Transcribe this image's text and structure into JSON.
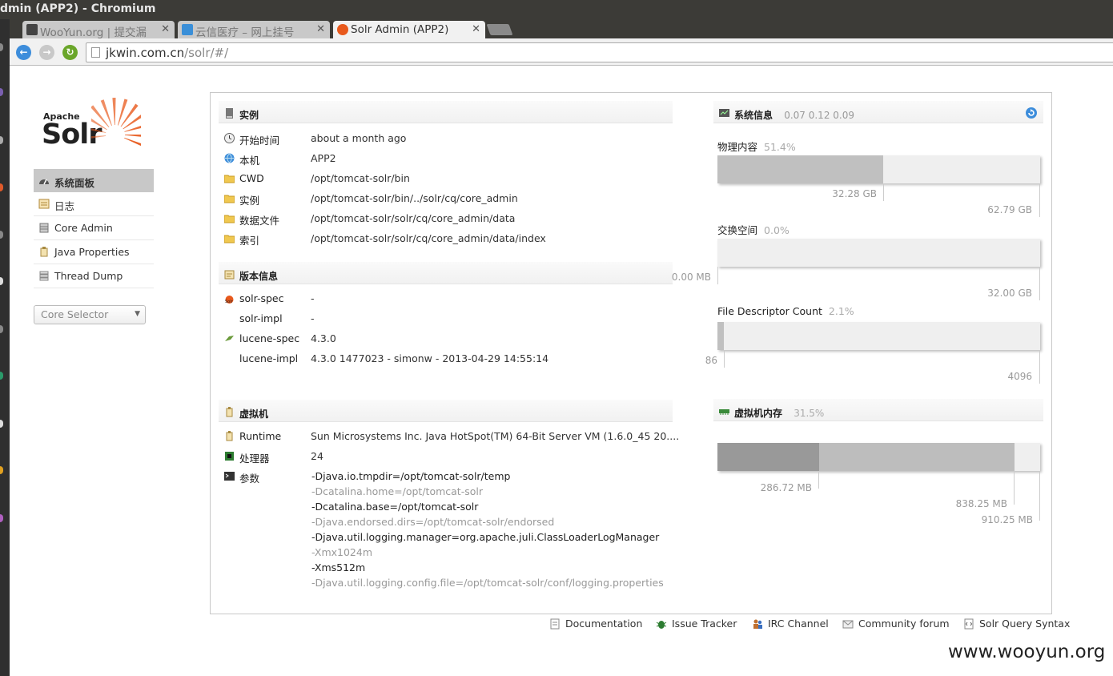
{
  "window": {
    "title": "dmin (APP2) - Chromium"
  },
  "tabs": [
    {
      "label": "WooYun.org | 提交漏",
      "favicon_color": "#444444"
    },
    {
      "label": "云信医疗 – 网上挂号",
      "favicon_color": "#3a8fd8"
    },
    {
      "label": "Solr Admin (APP2)",
      "favicon_color": "#e8591c"
    }
  ],
  "omnibox": {
    "host": "jkwin.com.cn",
    "path": "/solr/#/"
  },
  "nav": {
    "back": "←",
    "forward": "→",
    "reload": "↻"
  },
  "logo": {
    "apache": "Apache",
    "solr": "Solr"
  },
  "menu": [
    {
      "label": "系统面板"
    },
    {
      "label": "日志"
    },
    {
      "label": "Core Admin"
    },
    {
      "label": "Java Properties"
    },
    {
      "label": "Thread Dump"
    }
  ],
  "core_selector": {
    "placeholder": "Core Selector"
  },
  "instance": {
    "title": "实例",
    "rows": [
      {
        "k": "开始时间",
        "v": "about a month ago"
      },
      {
        "k": "本机",
        "v": "APP2"
      },
      {
        "k": "CWD",
        "v": "/opt/tomcat-solr/bin"
      },
      {
        "k": "实例",
        "v": "/opt/tomcat-solr/bin/../solr/cq/core_admin"
      },
      {
        "k": "数据文件",
        "v": "/opt/tomcat-solr/solr/cq/core_admin/data"
      },
      {
        "k": "索引",
        "v": "/opt/tomcat-solr/solr/cq/core_admin/data/index"
      }
    ]
  },
  "versions": {
    "title": "版本信息",
    "rows": [
      {
        "k": "solr-spec",
        "v": "-"
      },
      {
        "k": "solr-impl",
        "v": "-"
      },
      {
        "k": "lucene-spec",
        "v": "4.3.0"
      },
      {
        "k": "lucene-impl",
        "v": "4.3.0 1477023 - simonw - 2013-04-29 14:55:14"
      }
    ]
  },
  "jvm": {
    "title": "虚拟机",
    "rows": [
      {
        "k": "Runtime",
        "v": "Sun Microsystems Inc. Java HotSpot(TM) 64-Bit Server VM (1.6.0_45 20...."
      },
      {
        "k": "处理器",
        "v": "24"
      },
      {
        "k": "参数",
        "v": ""
      }
    ],
    "args": [
      "-Djava.io.tmpdir=/opt/tomcat-solr/temp",
      "-Dcatalina.home=/opt/tomcat-solr",
      "-Dcatalina.base=/opt/tomcat-solr",
      "-Djava.endorsed.dirs=/opt/tomcat-solr/endorsed",
      "-Djava.util.logging.manager=org.apache.juli.ClassLoaderLogManager",
      "-Xmx1024m",
      "-Xms512m",
      "-Djava.util.logging.config.file=/opt/tomcat-solr/conf/logging.properties"
    ]
  },
  "system": {
    "title": "系统信息",
    "loads": "0.07  0.12  0.09",
    "physical": {
      "label": "物理内容",
      "pct": "51.4%",
      "used": "32.28 GB",
      "total": "62.79 GB",
      "fraction": 0.514
    },
    "swap": {
      "label": "交换空间",
      "pct": "0.0%",
      "used": "0.00 MB",
      "total": "32.00 GB",
      "fraction": 0.0
    },
    "fd": {
      "label": "File Descriptor Count",
      "pct": "2.1%",
      "used": "86",
      "total": "4096",
      "fraction": 0.021
    }
  },
  "jvm_memory": {
    "title": "虚拟机内存",
    "pct": "31.5%",
    "used": "286.72 MB",
    "committed": "838.25 MB",
    "max": "910.25 MB",
    "used_fraction": 0.315,
    "committed_fraction": 0.921
  },
  "footer": [
    {
      "label": "Documentation"
    },
    {
      "label": "Issue Tracker"
    },
    {
      "label": "IRC Channel"
    },
    {
      "label": "Community forum"
    },
    {
      "label": "Solr Query Syntax"
    }
  ],
  "watermark": "www.wooyun.org",
  "colors": {
    "accent": "#e8591c",
    "bar_fill": "#c0c0c0",
    "jvm_used": "#999999",
    "jvm_committed": "#bdbdbd",
    "track": "#efefef"
  }
}
